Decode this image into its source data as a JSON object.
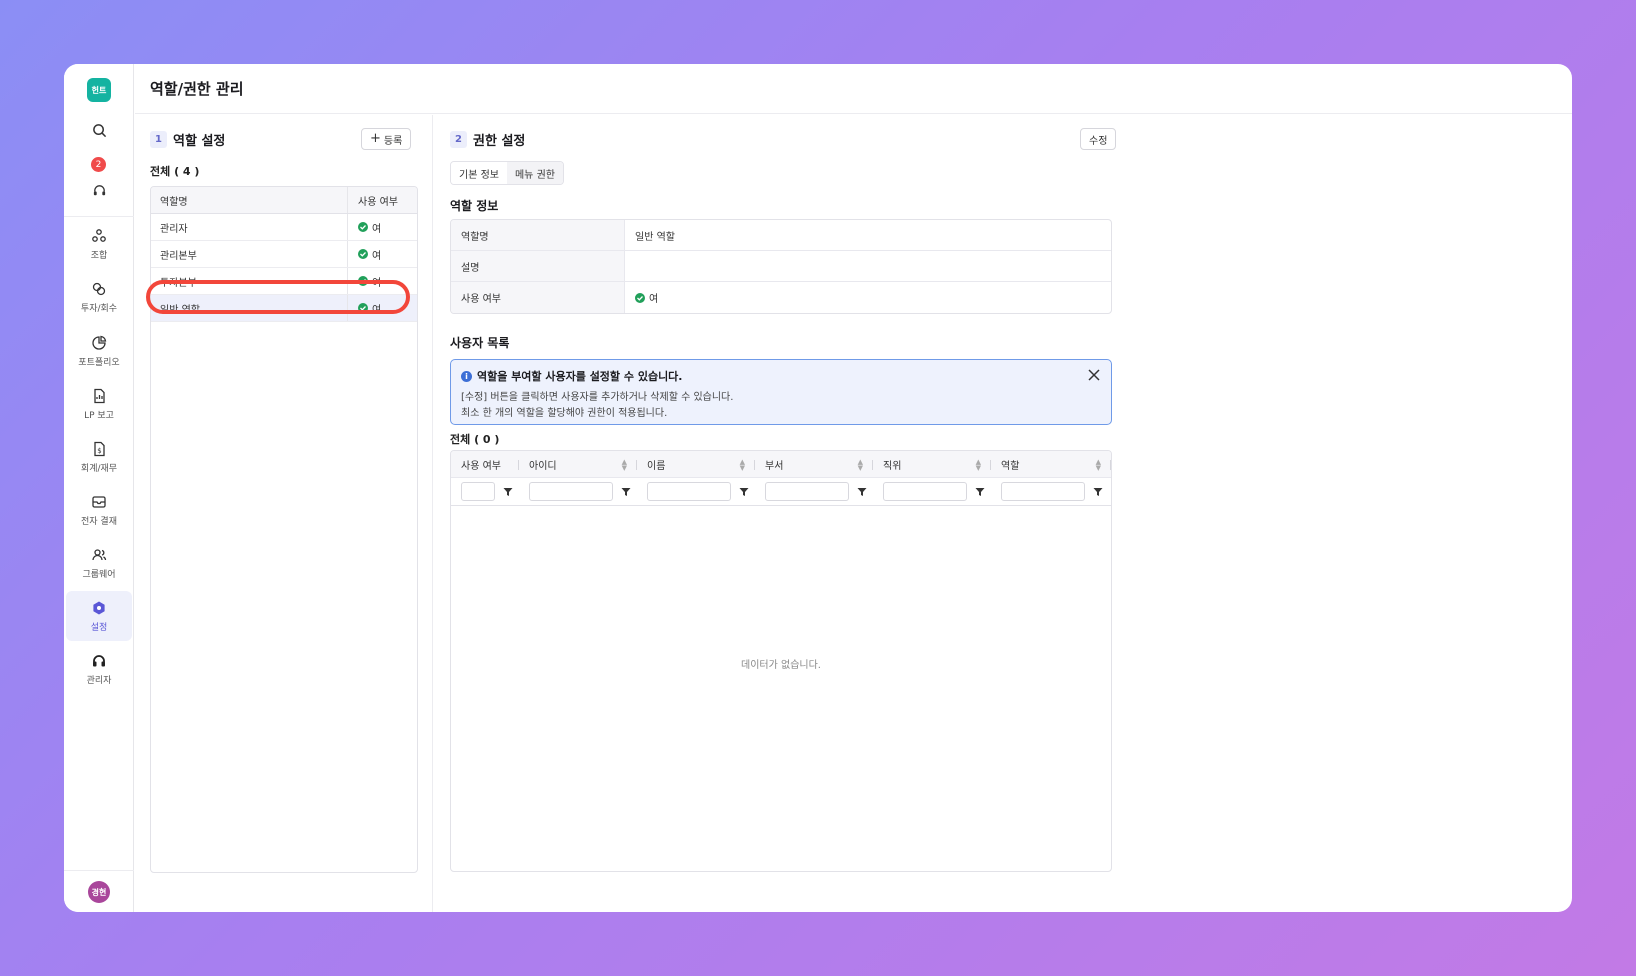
{
  "app": {
    "logo_text": "헌트",
    "page_title": "역할/권한 관리",
    "user_avatar": "경현"
  },
  "sidebar": {
    "notification_count": "2",
    "items": [
      {
        "label": "조합",
        "icon": "union-icon"
      },
      {
        "label": "투자/회수",
        "icon": "investment-icon"
      },
      {
        "label": "포트폴리오",
        "icon": "portfolio-icon"
      },
      {
        "label": "LP 보고",
        "icon": "report-icon"
      },
      {
        "label": "회계/재무",
        "icon": "accounting-icon"
      },
      {
        "label": "전자 결재",
        "icon": "approval-icon"
      },
      {
        "label": "그룹웨어",
        "icon": "groupware-icon"
      },
      {
        "label": "설정",
        "icon": "settings-icon",
        "active": true
      },
      {
        "label": "관리자",
        "icon": "admin-icon"
      }
    ]
  },
  "roles_panel": {
    "step": "1",
    "title": "역할 설정",
    "add_button": "등록",
    "count_label": "전체 ( 4 )",
    "columns": [
      "역할명",
      "사용 여부"
    ],
    "rows": [
      {
        "name": "관리자",
        "status": "여"
      },
      {
        "name": "관리본부",
        "status": "여"
      },
      {
        "name": "투자본부",
        "status": "여"
      },
      {
        "name": "일반 역할",
        "status": "여",
        "selected": true
      }
    ]
  },
  "permission_panel": {
    "step": "2",
    "title": "권한 설정",
    "edit_button": "수정",
    "tabs": [
      "기본 정보",
      "메뉴 권한"
    ],
    "role_info_title": "역할 정보",
    "role_info": [
      {
        "label": "역할명",
        "value": "일반 역할"
      },
      {
        "label": "설명",
        "value": ""
      },
      {
        "label": "사용 여부",
        "value": "여"
      }
    ],
    "user_list_title": "사용자 목록",
    "alert": {
      "title": "역할을 부여할 사용자를 설정할 수 있습니다.",
      "line1": "[수정] 버튼을 클릭하면 사용자를 추가하거나 삭제할 수 있습니다.",
      "line2": "최소 한 개의 역할을 할당해야 권한이 적용됩니다."
    },
    "user_count_label": "전체 ( 0 )",
    "user_columns": [
      "사용 여부",
      "아이디",
      "이름",
      "부서",
      "직위",
      "역할"
    ],
    "empty_text": "데이터가 없습니다."
  },
  "colors": {
    "accent": "#5a57d6",
    "highlight_ring": "#f2463a",
    "success": "#21a05a",
    "logo": "#14b3a1"
  }
}
